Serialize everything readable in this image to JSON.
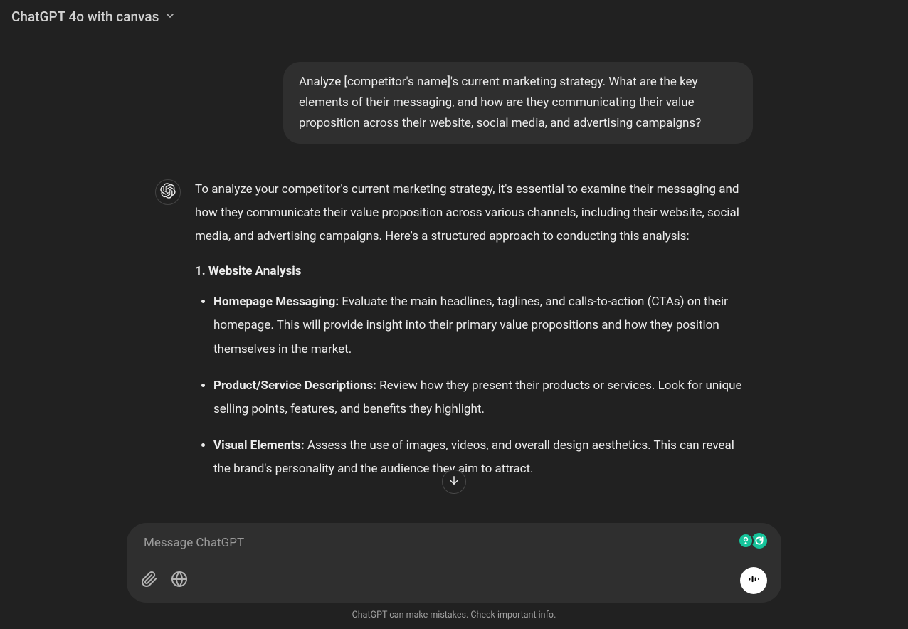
{
  "header": {
    "model_label": "ChatGPT 4o with canvas"
  },
  "conversation": {
    "user_message": "Analyze [competitor's name]'s current marketing strategy. What are the key elements of their messaging, and how are they communicating their value proposition across their website, social media, and advertising campaigns?",
    "assistant": {
      "intro": "To analyze your competitor's current marketing strategy, it's essential to examine their messaging and how they communicate their value proposition across various channels, including their website, social media, and advertising campaigns. Here's a structured approach to conducting this analysis:",
      "section1_heading": "1. Website Analysis",
      "bullets": [
        {
          "label": "Homepage Messaging:",
          "text": " Evaluate the main headlines, taglines, and calls-to-action (CTAs) on their homepage. This will provide insight into their primary value propositions and how they position themselves in the market."
        },
        {
          "label": "Product/Service Descriptions:",
          "text": " Review how they present their products or services. Look for unique selling points, features, and benefits they highlight."
        },
        {
          "label": "Visual Elements:",
          "text": " Assess the use of images, videos, and overall design aesthetics. This can reveal the brand's personality and the audience they aim to attract."
        }
      ]
    }
  },
  "composer": {
    "placeholder": "Message ChatGPT"
  },
  "footer": {
    "disclaimer": "ChatGPT can make mistakes. Check important info."
  },
  "colors": {
    "bg": "#212121",
    "bubble": "#2f2f2f",
    "fg": "#ececec",
    "muted": "#9a9a9a",
    "grammarly": "#15c39a"
  }
}
